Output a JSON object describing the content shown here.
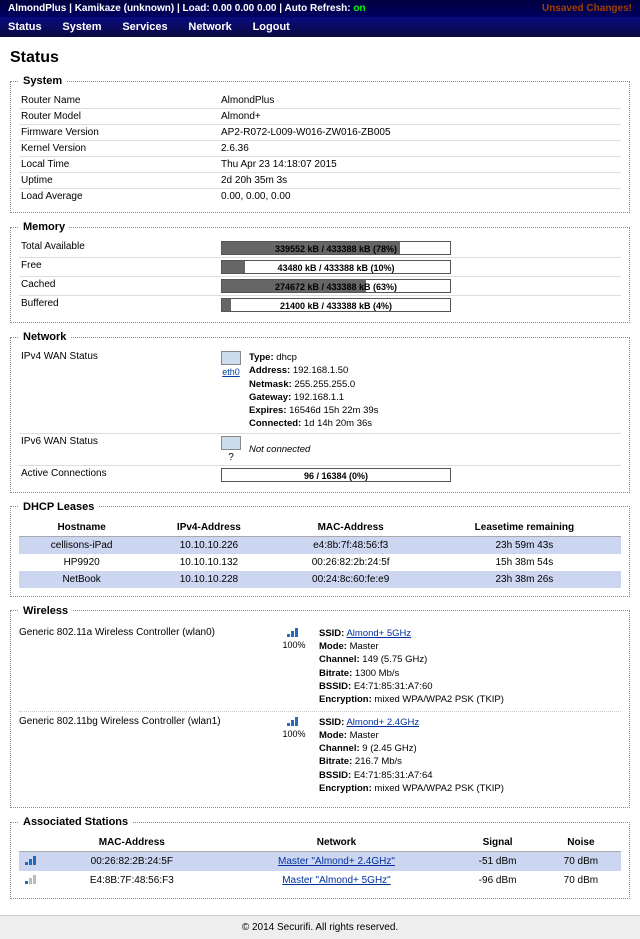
{
  "top": {
    "host": "AlmondPlus",
    "firmware": "Kamikaze (unknown)",
    "load_label": "Load:",
    "load": "0.00 0.00 0.00",
    "auto_refresh_label": "Auto Refresh:",
    "auto_refresh": "on",
    "changes": "Unsaved Changes!"
  },
  "nav": {
    "status": "Status",
    "system": "System",
    "services": "Services",
    "network": "Network",
    "logout": "Logout"
  },
  "title": "Status",
  "system": {
    "legend": "System",
    "rows": {
      "router_name_k": "Router Name",
      "router_name_v": "AlmondPlus",
      "router_model_k": "Router Model",
      "router_model_v": "Almond+",
      "fw_k": "Firmware Version",
      "fw_v": "AP2-R072-L009-W016-ZW016-ZB005",
      "kernel_k": "Kernel Version",
      "kernel_v": "2.6.36",
      "time_k": "Local Time",
      "time_v": "Thu Apr 23 14:18:07 2015",
      "uptime_k": "Uptime",
      "uptime_v": "2d 20h 35m 3s",
      "loadavg_k": "Load Average",
      "loadavg_v": "0.00, 0.00, 0.00"
    }
  },
  "memory": {
    "legend": "Memory",
    "rows": [
      {
        "k": "Total Available",
        "txt": "339552 kB / 433388 kB (78%)",
        "pct": 78
      },
      {
        "k": "Free",
        "txt": "43480 kB / 433388 kB (10%)",
        "pct": 10
      },
      {
        "k": "Cached",
        "txt": "274672 kB / 433388 kB (63%)",
        "pct": 63
      },
      {
        "k": "Buffered",
        "txt": "21400 kB / 433388 kB (4%)",
        "pct": 4
      }
    ]
  },
  "network": {
    "legend": "Network",
    "ipv4_label": "IPv4 WAN Status",
    "iface": "eth0",
    "ipv4": {
      "Type": "dhcp",
      "Address": "192.168.1.50",
      "Netmask": "255.255.255.0",
      "Gateway": "192.168.1.1",
      "Expires": "16546d 15h 22m 39s",
      "Connected": "1d 14h 20m 36s"
    },
    "ipv6_label": "IPv6 WAN Status",
    "ipv6_iface": "?",
    "ipv6_status": "Not connected",
    "active_label": "Active Connections",
    "active_txt": "96 / 16384 (0%)",
    "active_pct": 0
  },
  "dhcp": {
    "legend": "DHCP Leases",
    "headers": {
      "host": "Hostname",
      "ip": "IPv4-Address",
      "mac": "MAC-Address",
      "lease": "Leasetime remaining"
    },
    "rows": [
      {
        "host": "cellisons-iPad",
        "ip": "10.10.10.226",
        "mac": "e4:8b:7f:48:56:f3",
        "lease": "23h 59m 43s",
        "alt": true
      },
      {
        "host": "HP9920",
        "ip": "10.10.10.132",
        "mac": "00:26:82:2b:24:5f",
        "lease": "15h 38m 54s",
        "alt": false
      },
      {
        "host": "NetBook",
        "ip": "10.10.10.228",
        "mac": "00:24:8c:60:fe:e9",
        "lease": "23h 38m 26s",
        "alt": true
      }
    ]
  },
  "wireless": {
    "legend": "Wireless",
    "radios": [
      {
        "label": "Generic 802.11a Wireless Controller (wlan0)",
        "pct": "100%",
        "ssid": "Almond+ 5GHz",
        "mode": "Master",
        "channel": "149 (5.75 GHz)",
        "bitrate": "1300 Mb/s",
        "bssid": "E4:71:85:31:A7:60",
        "enc": "mixed WPA/WPA2 PSK (TKIP)"
      },
      {
        "label": "Generic 802.11bg Wireless Controller (wlan1)",
        "pct": "100%",
        "ssid": "Almond+ 2.4GHz",
        "mode": "Master",
        "channel": "9 (2.45 GHz)",
        "bitrate": "216.7 Mb/s",
        "bssid": "E4:71:85:31:A7:64",
        "enc": "mixed WPA/WPA2 PSK (TKIP)"
      }
    ],
    "labels": {
      "ssid": "SSID:",
      "mode": "Mode:",
      "channel": "Channel:",
      "bitrate": "Bitrate:",
      "bssid": "BSSID:",
      "enc": "Encryption:"
    }
  },
  "assoc": {
    "legend": "Associated Stations",
    "headers": {
      "mac": "MAC-Address",
      "net": "Network",
      "sig": "Signal",
      "noise": "Noise"
    },
    "rows": [
      {
        "mac": "00:26:82:2B:24:5F",
        "net": "Master \"Almond+ 2.4GHz\"",
        "sig": "-51 dBm",
        "noise": "70 dBm",
        "alt": true,
        "low": false
      },
      {
        "mac": "E4:8B:7F:48:56:F3",
        "net": "Master \"Almond+ 5GHz\"",
        "sig": "-96 dBm",
        "noise": "70 dBm",
        "alt": false,
        "low": true
      }
    ]
  },
  "footer": "© 2014 Securifi. All rights reserved."
}
